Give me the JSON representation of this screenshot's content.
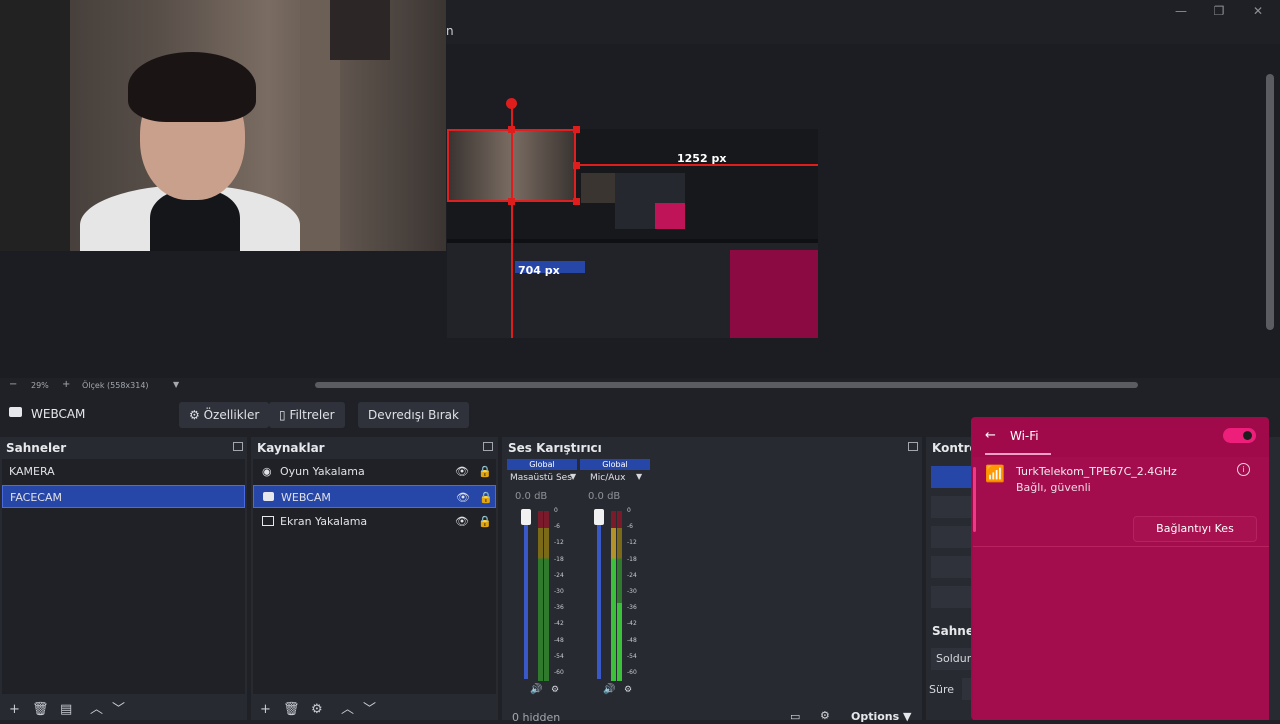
{
  "window": {
    "title_fragment": "n",
    "controls": {
      "minimize": "—",
      "maximize": "❐",
      "close": "✕"
    }
  },
  "preview": {
    "width_label": "1252 px",
    "height_label": "704 px",
    "zoom_minus": "−",
    "zoom_value": "29%",
    "zoom_plus": "+",
    "scale_label": "Ölçek (558x314)",
    "scale_caret": "▼"
  },
  "toolbar": {
    "source_name": "WEBCAM",
    "properties_label": "Özellikler",
    "filters_label": "Filtreler",
    "disable_label": "Devredışı Bırak"
  },
  "scenes": {
    "title": "Sahneler",
    "items": [
      {
        "label": "KAMERA"
      },
      {
        "label": "FACECAM"
      }
    ]
  },
  "sources": {
    "title": "Kaynaklar",
    "items": [
      {
        "label": "Oyun Yakalama",
        "icon": "gamepad-icon"
      },
      {
        "label": "WEBCAM",
        "icon": "camera-icon"
      },
      {
        "label": "Ekran Yakalama",
        "icon": "monitor-icon"
      }
    ]
  },
  "mixer": {
    "title": "Ses Karıştırıcı",
    "global_label": "Global",
    "channels": [
      {
        "name": "Masaüstü Ses",
        "db": "0.0 dB",
        "level": 0.7
      },
      {
        "name": "Mic/Aux",
        "db": "0.0 dB",
        "level": 0.55
      }
    ],
    "scale": [
      "0",
      "-6",
      "-12",
      "-18",
      "-24",
      "-30",
      "-36",
      "-42",
      "-48",
      "-54",
      "-60"
    ],
    "footer": "0 hidden",
    "options_label": "Options"
  },
  "controls": {
    "title": "Kontrol",
    "transitions_title": "Sahne G",
    "transition_value": "Soldur",
    "duration_label": "Süre"
  },
  "wifi": {
    "title": "Wi-Fi",
    "enabled": true,
    "network_name": "TurkTelekom_TPE67C_2.4GHz",
    "network_status": "Bağlı, güvenli",
    "disconnect_label": "Bağlantıyı Kes",
    "accent_color": "#a10a4a"
  },
  "colors": {
    "selection": "#2747a8",
    "bounding_box": "#e01d1d"
  }
}
